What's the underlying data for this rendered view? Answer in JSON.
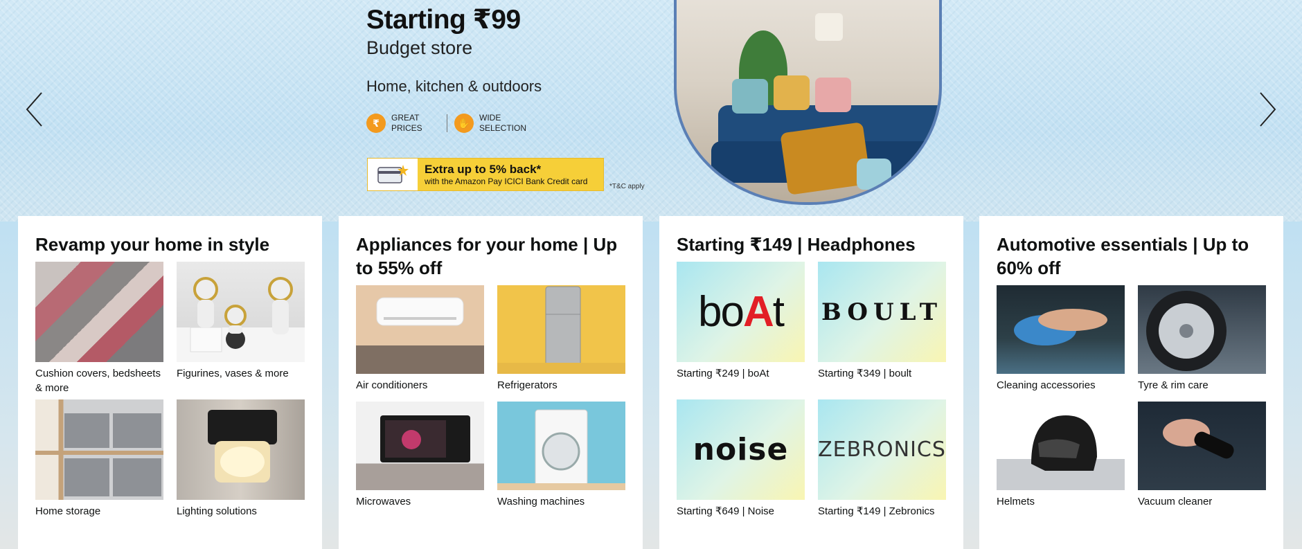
{
  "hero": {
    "title": "Starting ₹99",
    "subtitle": "Budget store",
    "tagline": "Home, kitchen & outdoors",
    "badges": [
      "GREAT PRICES",
      "WIDE SELECTION"
    ],
    "offer_main": "Extra up to 5% back*",
    "offer_sub": "with the Amazon Pay ICICI Bank Credit card",
    "tnc": "*T&C apply"
  },
  "cards": [
    {
      "title": "Revamp your home in style",
      "tiles": [
        {
          "label": "Cushion covers, bedsheets & more"
        },
        {
          "label": "Figurines, vases & more"
        },
        {
          "label": "Home storage"
        },
        {
          "label": "Lighting solutions"
        }
      ]
    },
    {
      "title": "Appliances for your home | Up to 55% off",
      "tiles": [
        {
          "label": "Air conditioners"
        },
        {
          "label": "Refrigerators"
        },
        {
          "label": "Microwaves"
        },
        {
          "label": "Washing machines"
        }
      ]
    },
    {
      "title": "Starting ₹149 | Headphones",
      "tiles": [
        {
          "label": "Starting ₹249 | boAt",
          "brand": "boAt"
        },
        {
          "label": "Starting ₹349 | boult",
          "brand": "BOULT"
        },
        {
          "label": "Starting ₹649 | Noise",
          "brand": "noise"
        },
        {
          "label": "Starting ₹149 | Zebronics",
          "brand": "ZEBRONICS"
        }
      ]
    },
    {
      "title": "Automotive essentials | Up to 60% off",
      "tiles": [
        {
          "label": "Cleaning accessories"
        },
        {
          "label": "Tyre & rim care"
        },
        {
          "label": "Helmets"
        },
        {
          "label": "Vacuum cleaner"
        }
      ]
    }
  ],
  "icons": {
    "prev": "chevron-left-icon",
    "next": "chevron-right-icon"
  },
  "colors": {
    "offer_yellow": "#f6cf38",
    "badge_orange": "#f39a1e",
    "boat_red": "#e21f26"
  }
}
